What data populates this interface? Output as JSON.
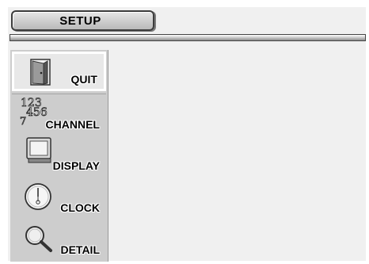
{
  "window": {
    "title": "SETUP"
  },
  "menu": {
    "items": [
      {
        "label": "QUIT",
        "icon": "door-icon",
        "selected": true
      },
      {
        "label": "CHANNEL",
        "icon": "channel-numbers-icon",
        "selected": false
      },
      {
        "label": "DISPLAY",
        "icon": "monitor-icon",
        "selected": false
      },
      {
        "label": "CLOCK",
        "icon": "clock-icon",
        "selected": false
      },
      {
        "label": "DETAIL",
        "icon": "magnifier-icon",
        "selected": false
      }
    ]
  },
  "colors": {
    "menu_background": "#cdcdcd",
    "screen_background": "#f0f0f0",
    "selected_background": "#e8e8e8"
  }
}
